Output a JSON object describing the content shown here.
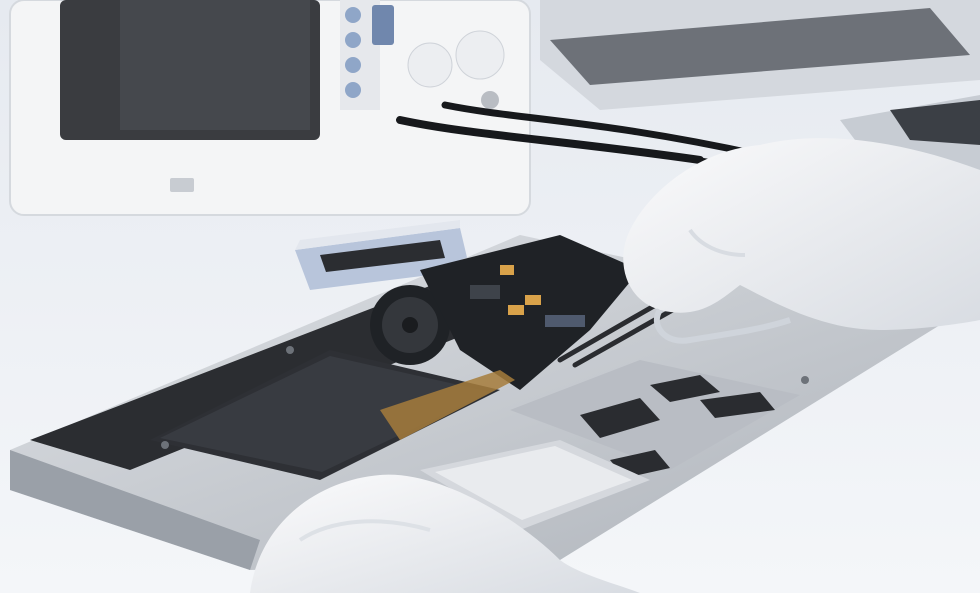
{
  "scene": {
    "palette": {
      "desk": "#eef1f5",
      "desk_shadow": "#d9dee6",
      "device_white": "#f6f7f8",
      "screen_dark": "#3a3c40",
      "laptop_silver": "#c9ccd1",
      "laptop_dark": "#2b2d31",
      "board_dark": "#1f2226",
      "component_orange": "#d9a24a",
      "glove_white": "#f1f2f4",
      "glove_shadow": "#cfd4db",
      "cable_black": "#17191c",
      "case_blue": "#b8c5db"
    }
  }
}
